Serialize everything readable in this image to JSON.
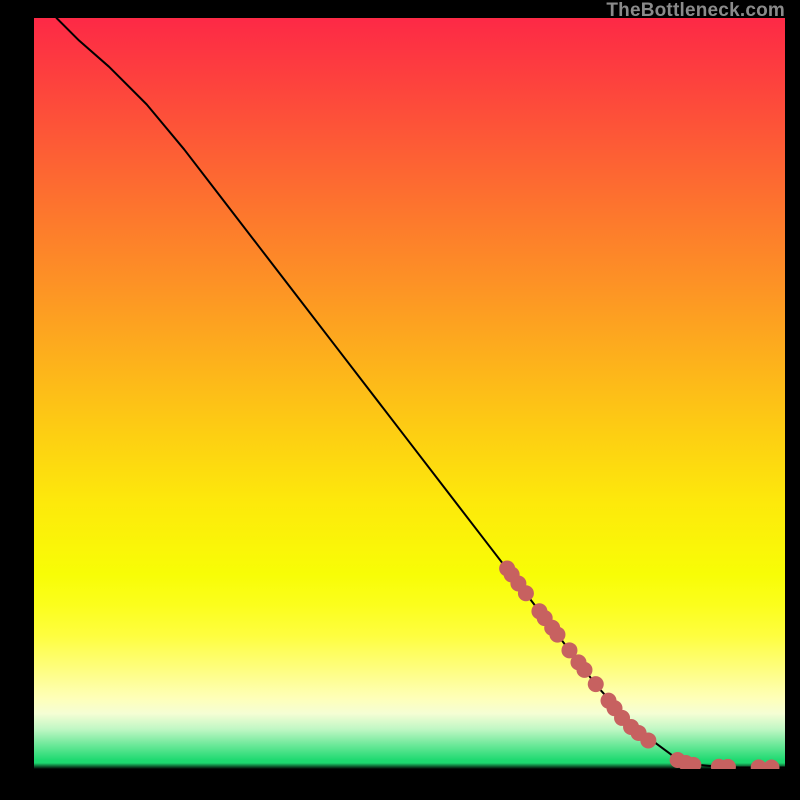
{
  "watermark": "TheBottleneck.com",
  "chart_data": {
    "type": "line",
    "title": "",
    "xlabel": "",
    "ylabel": "",
    "xlim": [
      0,
      100
    ],
    "ylim": [
      0,
      100
    ],
    "grid": false,
    "series": [
      {
        "name": "curve",
        "x": [
          3,
          6,
          10,
          15,
          20,
          25,
          30,
          35,
          40,
          45,
          50,
          55,
          60,
          65,
          70,
          75,
          80,
          85,
          88,
          91,
          94,
          97,
          100
        ],
        "y": [
          100,
          97,
          93.5,
          88.5,
          82.5,
          76,
          69.5,
          63,
          56.5,
          50,
          43.5,
          37,
          30.5,
          24,
          17.5,
          11,
          5.5,
          1.8,
          0.6,
          0.3,
          0.2,
          0.2,
          0.2
        ]
      }
    ],
    "dots": {
      "name": "dots",
      "color": "#c76160",
      "points": [
        {
          "x": 63.0,
          "y": 26.7
        },
        {
          "x": 63.6,
          "y": 25.9
        },
        {
          "x": 64.5,
          "y": 24.7
        },
        {
          "x": 65.5,
          "y": 23.4
        },
        {
          "x": 67.3,
          "y": 21.0
        },
        {
          "x": 68.0,
          "y": 20.1
        },
        {
          "x": 69.0,
          "y": 18.8
        },
        {
          "x": 69.7,
          "y": 17.9
        },
        {
          "x": 71.3,
          "y": 15.8
        },
        {
          "x": 72.5,
          "y": 14.2
        },
        {
          "x": 73.3,
          "y": 13.2
        },
        {
          "x": 74.8,
          "y": 11.3
        },
        {
          "x": 76.5,
          "y": 9.1
        },
        {
          "x": 77.3,
          "y": 8.1
        },
        {
          "x": 78.3,
          "y": 6.8
        },
        {
          "x": 79.5,
          "y": 5.6
        },
        {
          "x": 80.5,
          "y": 4.8
        },
        {
          "x": 81.8,
          "y": 3.8
        },
        {
          "x": 85.7,
          "y": 1.2
        },
        {
          "x": 86.8,
          "y": 0.8
        },
        {
          "x": 87.8,
          "y": 0.55
        },
        {
          "x": 91.2,
          "y": 0.3
        },
        {
          "x": 92.4,
          "y": 0.28
        },
        {
          "x": 96.5,
          "y": 0.22
        },
        {
          "x": 98.2,
          "y": 0.2
        }
      ]
    },
    "gradient_stops": [
      {
        "offset": 0.0,
        "color": "#fd2946"
      },
      {
        "offset": 0.069,
        "color": "#fd3d3f"
      },
      {
        "offset": 0.165,
        "color": "#fd5a36"
      },
      {
        "offset": 0.261,
        "color": "#fd772d"
      },
      {
        "offset": 0.357,
        "color": "#fd9325"
      },
      {
        "offset": 0.453,
        "color": "#fdb01c"
      },
      {
        "offset": 0.549,
        "color": "#fdcd13"
      },
      {
        "offset": 0.645,
        "color": "#fde90b"
      },
      {
        "offset": 0.741,
        "color": "#f8fd06"
      },
      {
        "offset": 0.782,
        "color": "#fbfe1d"
      },
      {
        "offset": 0.823,
        "color": "#fefe40"
      },
      {
        "offset": 0.864,
        "color": "#fefe7b"
      },
      {
        "offset": 0.906,
        "color": "#feffb9"
      },
      {
        "offset": 0.926,
        "color": "#f5fed4"
      },
      {
        "offset": 0.947,
        "color": "#c0f7c4"
      },
      {
        "offset": 0.967,
        "color": "#70e99b"
      },
      {
        "offset": 0.988,
        "color": "#1fda71"
      },
      {
        "offset": 0.992,
        "color": "#1dd86f"
      },
      {
        "offset": 1.0,
        "color": "#000000"
      }
    ]
  }
}
